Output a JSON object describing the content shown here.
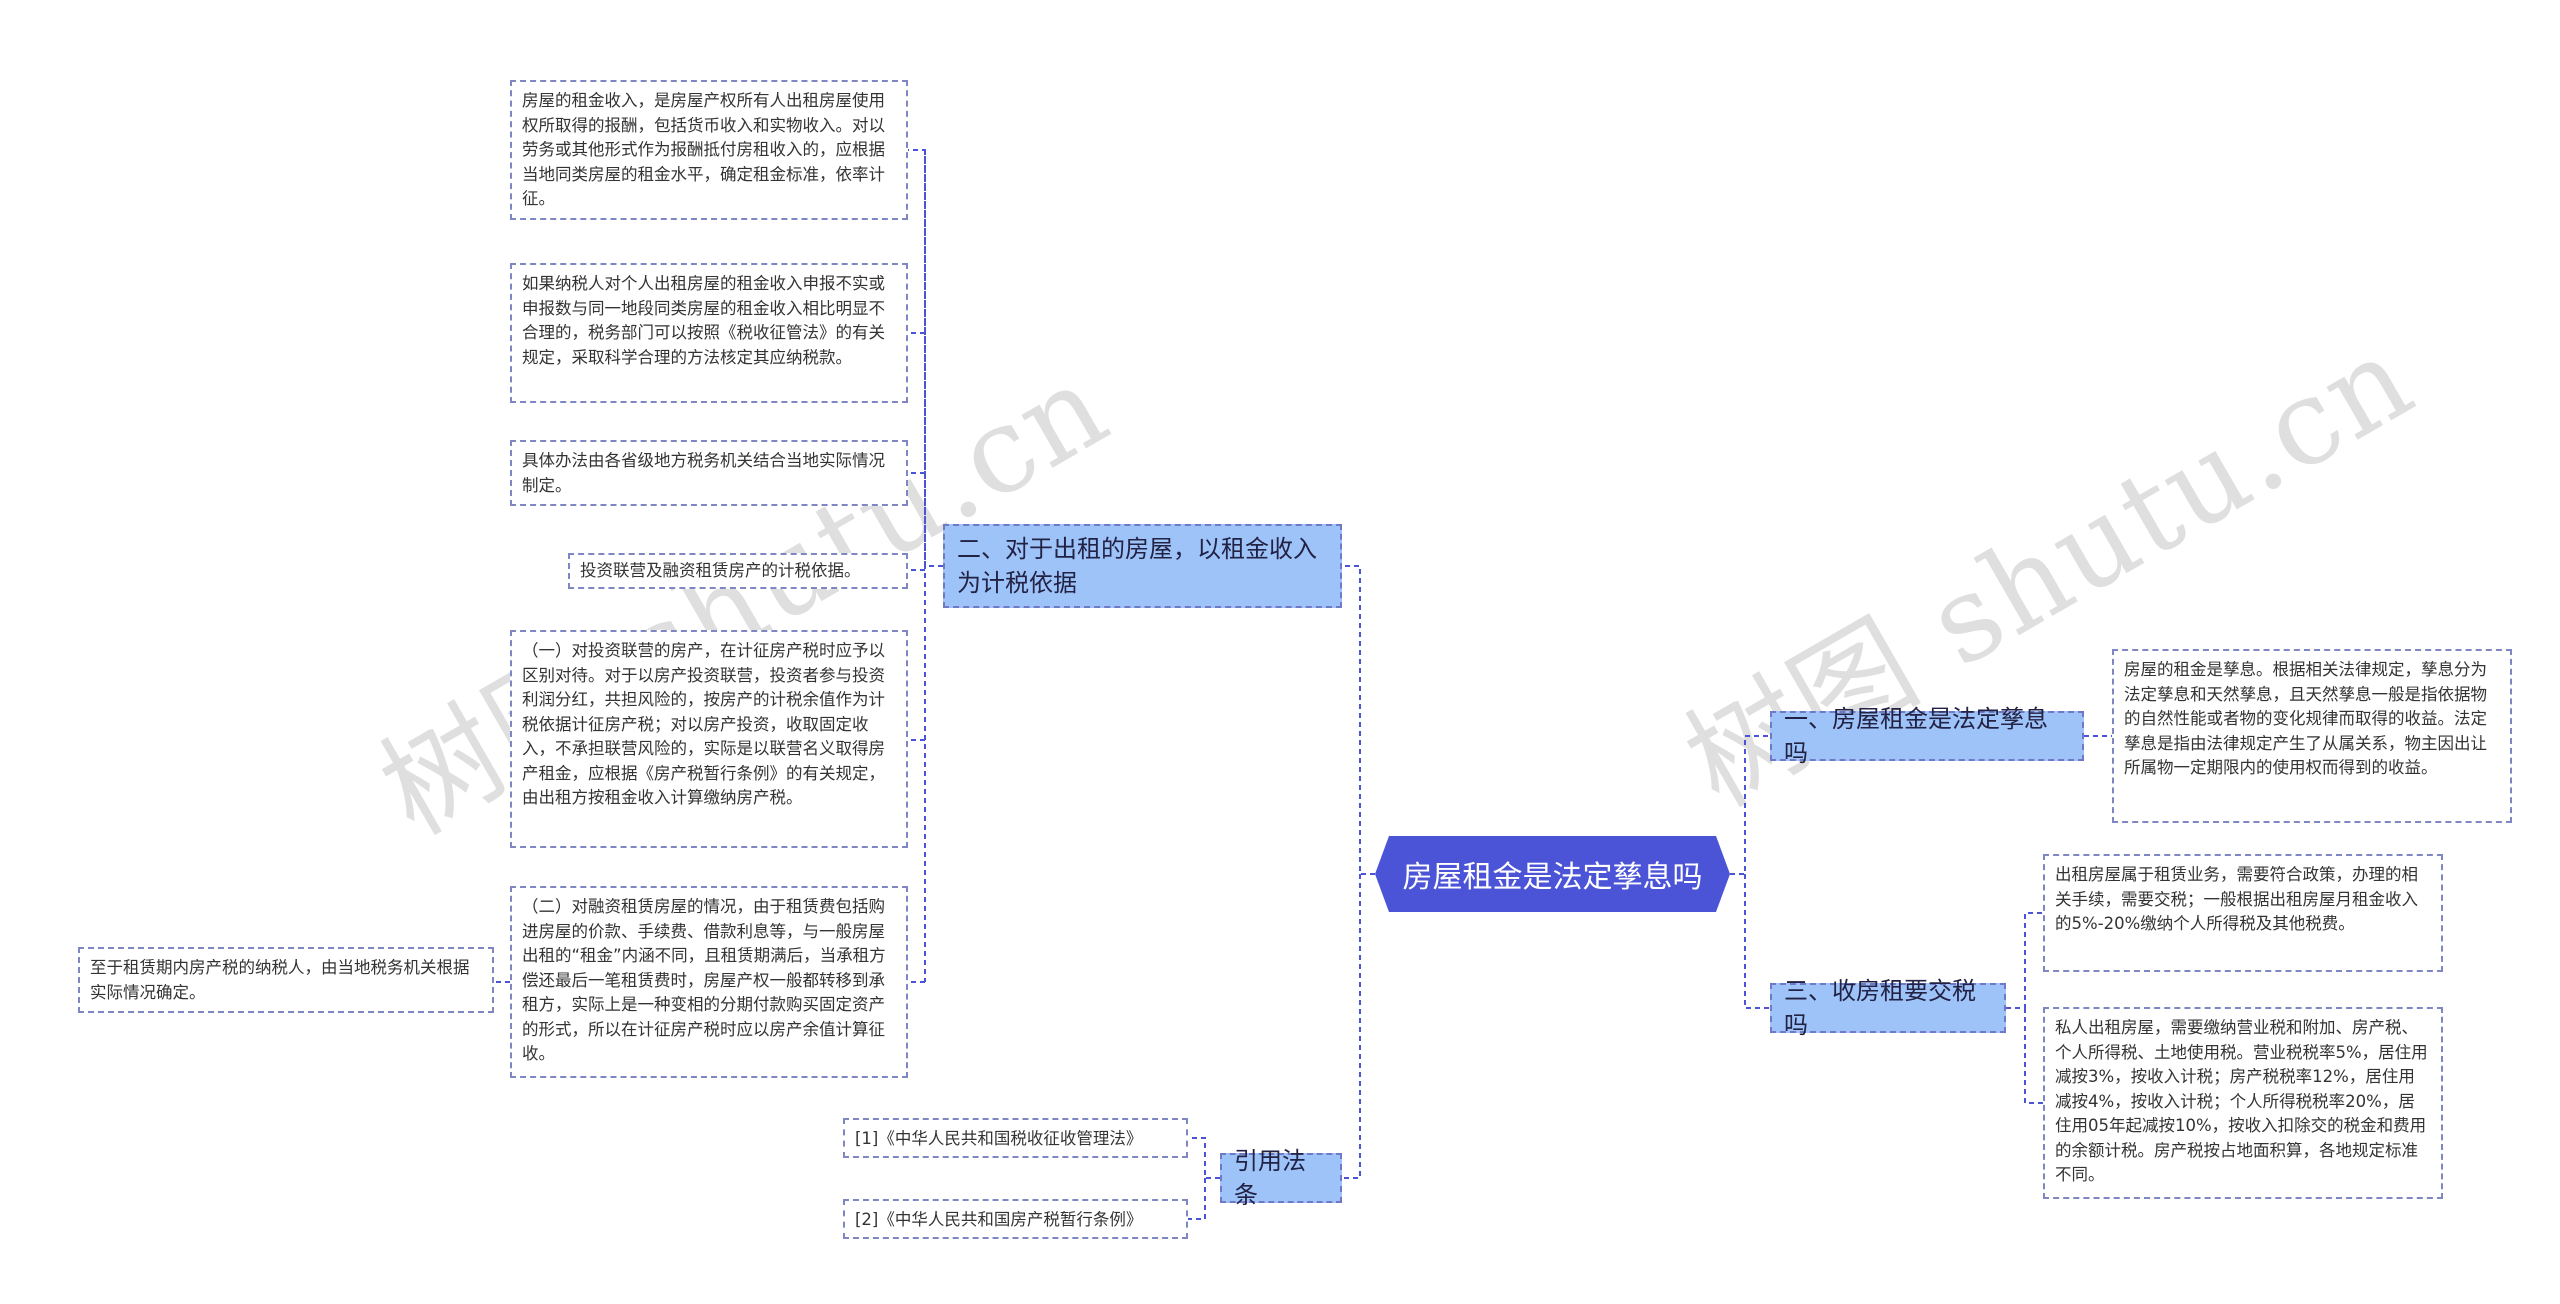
{
  "watermark": "树图 shutu.cn",
  "root": {
    "label": "房屋租金是法定孳息吗"
  },
  "left": {
    "b1": {
      "label": "二、对于出租的房屋，以租金收入为计税依据",
      "leaves": [
        "房屋的租金收入，是房屋产权所有人出租房屋使用权所取得的报酬，包括货币收入和实物收入。对以劳务或其他形式作为报酬抵付房租收入的，应根据当地同类房屋的租金水平，确定租金标准，依率计征。",
        "如果纳税人对个人出租房屋的租金收入申报不实或申报数与同一地段同类房屋的租金收入相比明显不合理的，税务部门可以按照《税收征管法》的有关规定，采取科学合理的方法核定其应纳税款。",
        "具体办法由各省级地方税务机关结合当地实际情况制定。",
        "投资联营及融资租赁房产的计税依据。",
        "（一）对投资联营的房产，在计征房产税时应予以区别对待。对于以房产投资联营，投资者参与投资利润分红，共担风险的，按房产的计税余值作为计税依据计征房产税；对以房产投资，收取固定收入，不承担联营风险的，实际是以联营名义取得房产租金，应根据《房产税暂行条例》的有关规定，由出租方按租金收入计算缴纳房产税。",
        "（二）对融资租赁房屋的情况，由于租赁费包括购进房屋的价款、手续费、借款利息等，与一般房屋出租的“租金”内涵不同，且租赁期满后，当承租方偿还最后一笔租赁费时，房屋产权一般都转移到承租方，实际上是一种变相的分期付款购买固定资产的形式，所以在计征房产税时应以房产余值计算征收。"
      ],
      "far": "至于租赁期内房产税的纳税人，由当地税务机关根据实际情况确定。"
    },
    "b2": {
      "label": "引用法条",
      "leaves": [
        "[1]《中华人民共和国税收征收管理法》",
        "[2]《中华人民共和国房产税暂行条例》"
      ]
    }
  },
  "right": {
    "b1": {
      "label": "一、房屋租金是法定孳息吗",
      "leaves": [
        "房屋的租金是孳息。根据相关法律规定，孳息分为法定孳息和天然孳息，且天然孳息一般是指依据物的自然性能或者物的变化规律而取得的收益。法定孳息是指由法律规定产生了从属关系，物主因出让所属物一定期限内的使用权而得到的收益。"
      ]
    },
    "b2": {
      "label": "三、收房租要交税吗",
      "leaves": [
        "出租房屋属于租赁业务，需要符合政策，办理的相关手续，需要交税；一般根据出租房屋月租金收入的5%-20%缴纳个人所得税及其他税费。",
        "私人出租房屋，需要缴纳营业税和附加、房产税、个人所得税、土地使用税。营业税税率5%，居住用减按3%，按收入计税；房产税税率12%，居住用减按4%，按收入计税；个人所得税税率20%，居住用05年起减按10%，按收入扣除交的税金和费用的余额计税。房产税按占地面积算，各地规定标准不同。"
      ]
    }
  },
  "colors": {
    "root": "#4b53d7",
    "branch": "#9ec3f9",
    "line": "#4b53d7",
    "leaf_border": "#7f86c4"
  }
}
